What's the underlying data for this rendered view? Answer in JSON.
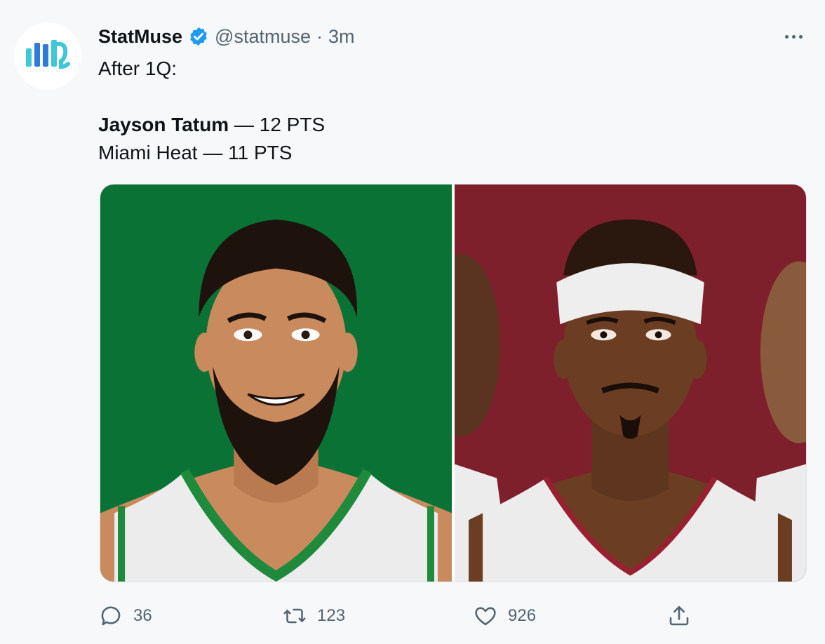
{
  "tweet": {
    "display_name": "StatMuse",
    "handle": "@statmuse",
    "separator": "·",
    "time": "3m",
    "line1": "After 1Q:",
    "player_name": "Jayson Tatum",
    "player_stat": " — 12 PTS",
    "team_line": "Miami Heat — 11 PTS"
  },
  "media": {
    "left_bg": "#0a7234",
    "right_bg": "#7e1f2c"
  },
  "actions": {
    "reply_count": "36",
    "retweet_count": "123",
    "like_count": "926"
  },
  "icons": {
    "avatar": "statmuse-logo-icon",
    "verified": "verified-badge-icon",
    "more": "more-options-icon",
    "reply": "reply-icon",
    "retweet": "retweet-icon",
    "like": "heart-icon",
    "share": "share-icon"
  },
  "colors": {
    "logo_blue": "#2f7bd8",
    "logo_teal": "#3ec7d9",
    "verified_blue": "#1d9bf0",
    "muted_text": "#536471"
  }
}
